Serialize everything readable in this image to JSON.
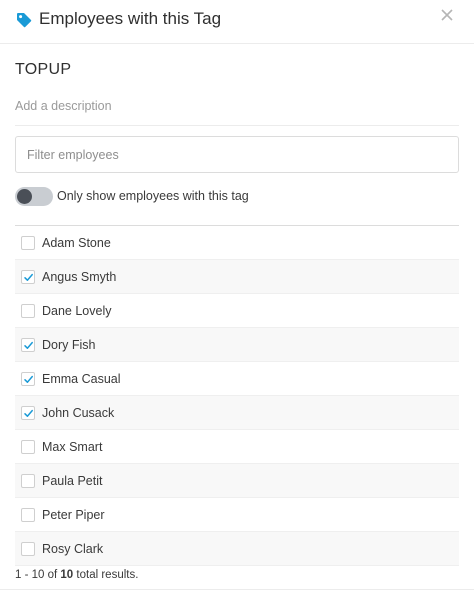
{
  "header": {
    "title": "Employees with this Tag",
    "tag_icon": "tag-icon",
    "close_icon": "close-icon",
    "accent_color": "#1a9ad6"
  },
  "tag": {
    "name": "TOPUP",
    "description_placeholder": "Add a description"
  },
  "filter": {
    "placeholder": "Filter employees",
    "value": ""
  },
  "toggle": {
    "label": "Only show employees with this tag",
    "on": false
  },
  "employees": [
    {
      "name": "Adam Stone",
      "checked": false
    },
    {
      "name": "Angus Smyth",
      "checked": true
    },
    {
      "name": "Dane Lovely",
      "checked": false
    },
    {
      "name": "Dory Fish",
      "checked": true
    },
    {
      "name": "Emma Casual",
      "checked": true
    },
    {
      "name": "John Cusack",
      "checked": true
    },
    {
      "name": "Max Smart",
      "checked": false
    },
    {
      "name": "Paula Petit",
      "checked": false
    },
    {
      "name": "Peter Piper",
      "checked": false
    },
    {
      "name": "Rosy Clark",
      "checked": false
    }
  ],
  "pagination": {
    "range": "1 - 10 of",
    "total": "10",
    "suffix": "total results."
  }
}
